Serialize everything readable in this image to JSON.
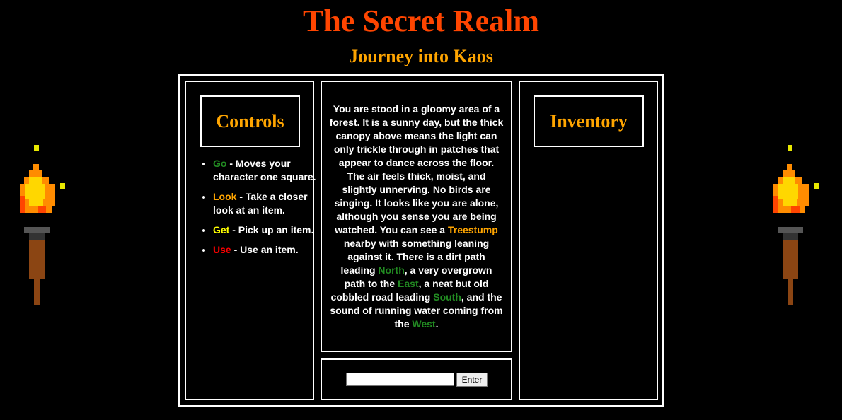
{
  "header": {
    "title": "The Secret Realm",
    "subtitle": "Journey into Kaos"
  },
  "controls": {
    "heading": "Controls",
    "items": [
      {
        "key": "Go",
        "desc": " - Moves your character one square.",
        "color": "#228b22"
      },
      {
        "key": "Look",
        "desc": " - Take a closer look at an item.",
        "color": "#ffa500"
      },
      {
        "key": "Get",
        "desc": " - Pick up an item.",
        "color": "#ffff00"
      },
      {
        "key": "Use",
        "desc": " - Use an item.",
        "color": "#ff0000"
      }
    ]
  },
  "description": {
    "part1": "You are stood in a gloomy area of a forest. It is a sunny day, but the thick canopy above means the light can only trickle through in patches that appear to dance across the floor. The air feels thick, moist, and slightly unnerving. No birds are singing. It looks like you are alone, although you sense you are being watched. You can see a ",
    "item": "Treestump",
    "part2": " nearby with something leaning against it. There is a dirt path leading ",
    "dir_north": "North",
    "part3": ", a very overgrown path to the ",
    "dir_east": "East",
    "part4": ", a neat but old cobbled road leading ",
    "dir_south": "South",
    "part5": ", and the sound of running water coming from the ",
    "dir_west": "West",
    "part6": "."
  },
  "command": {
    "input_value": "",
    "button_label": "Enter"
  },
  "inventory": {
    "heading": "Inventory"
  },
  "colors": {
    "title": "#ff4500",
    "subtitle": "#ffa500",
    "item": "#ffa500",
    "direction": "#228b22",
    "background": "#000000",
    "border": "#ffffff"
  },
  "decorations": {
    "left_icon": "torch-icon",
    "right_icon": "torch-icon"
  }
}
